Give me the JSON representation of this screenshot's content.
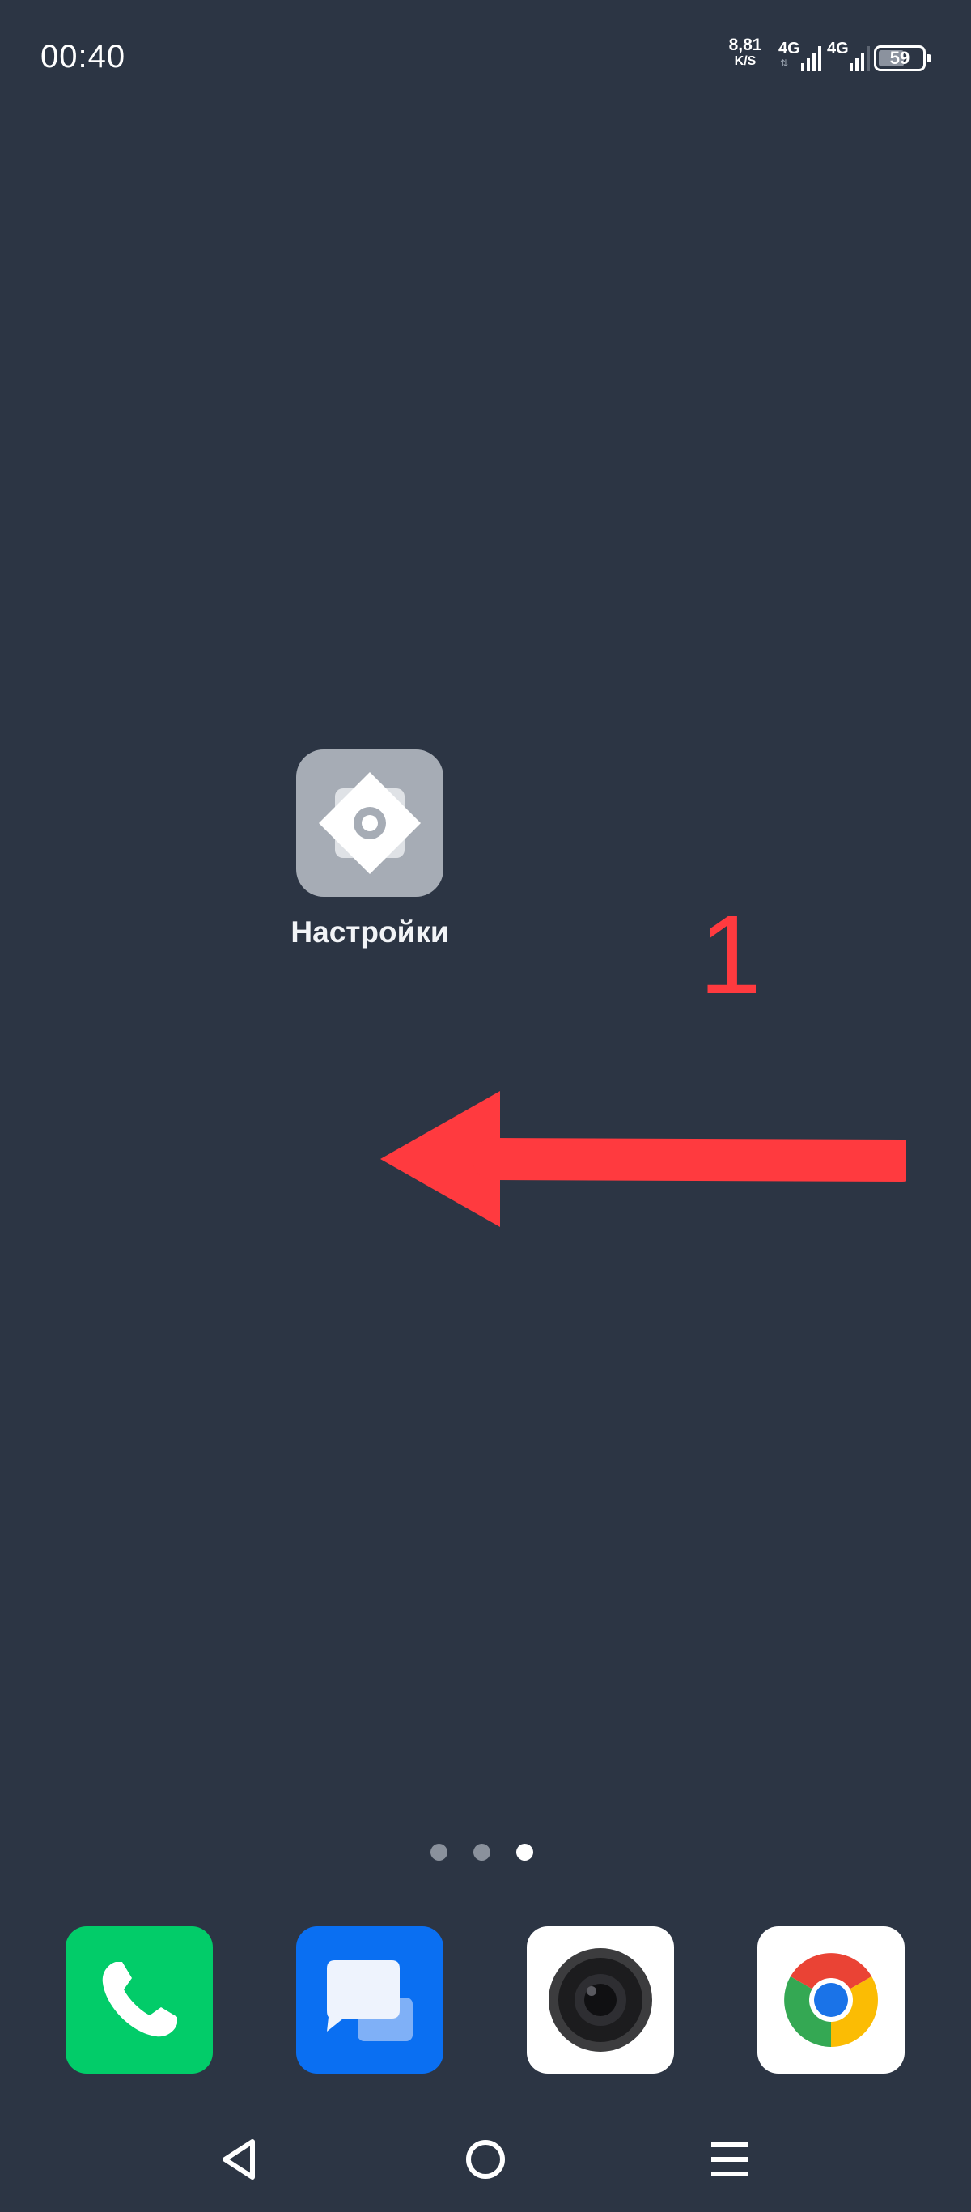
{
  "status_bar": {
    "time": "00:40",
    "net_speed_value": "8,81",
    "net_speed_unit": "K/S",
    "sim1_generation": "4G",
    "sim2_generation": "4G",
    "battery_level": 59,
    "battery_text": "59"
  },
  "home_screen": {
    "apps": [
      {
        "label": "Настройки",
        "icon": "settings-gear-icon"
      }
    ],
    "annotation_number": "1",
    "annotation_color": "#ff3a3f",
    "page_indicator": {
      "pages": 3,
      "active_page": 3
    }
  },
  "dock": [
    {
      "icon": "phone-icon",
      "color": "#02cc69"
    },
    {
      "icon": "messages-icon",
      "color": "#0a6ff2"
    },
    {
      "icon": "camera-icon",
      "color": "#ffffff"
    },
    {
      "icon": "chrome-icon",
      "color": "#ffffff"
    }
  ],
  "nav_bar": {
    "buttons": [
      "back-icon",
      "home-icon",
      "menu-icon"
    ]
  },
  "colors": {
    "background": "#2c3544",
    "settings_icon_bg": "#a6acb5"
  }
}
